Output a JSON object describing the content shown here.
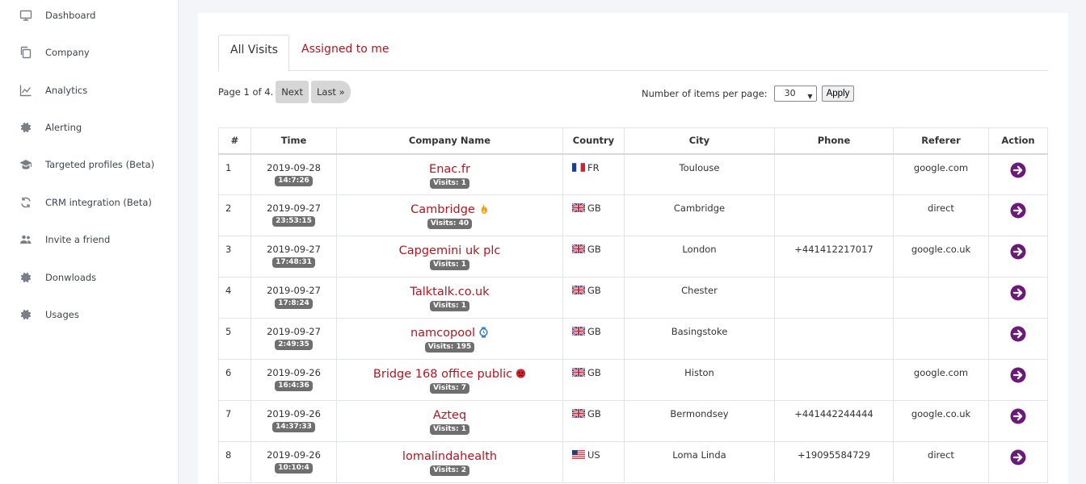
{
  "sidebar": {
    "items": [
      {
        "label": "Dashboard",
        "icon": "monitor-icon"
      },
      {
        "label": "Company",
        "icon": "copy-icon"
      },
      {
        "label": "Analytics",
        "icon": "line-chart-icon"
      },
      {
        "label": "Alerting",
        "icon": "gear-icon"
      },
      {
        "label": "Targeted profiles (Beta)",
        "icon": "graduation-cap-icon"
      },
      {
        "label": "CRM integration (Beta)",
        "icon": "sync-icon"
      },
      {
        "label": "Invite a friend",
        "icon": "users-icon"
      },
      {
        "label": "Donwloads",
        "icon": "gear-icon"
      },
      {
        "label": "Usages",
        "icon": "gear-icon"
      }
    ]
  },
  "tabs": [
    {
      "label": "All Visits",
      "active": true
    },
    {
      "label": "Assigned to me",
      "active": false
    }
  ],
  "pager": {
    "text": "Page 1 of 4.",
    "next_label": "Next",
    "last_label": "Last »"
  },
  "perpage": {
    "label": "Number of items per page:",
    "selected": "30",
    "apply_label": "Apply"
  },
  "table": {
    "headers": [
      "#",
      "Time",
      "Company Name",
      "Country",
      "City",
      "Phone",
      "Referer",
      "Action"
    ],
    "rows": [
      {
        "num": "1",
        "date": "2019-09-28",
        "time": "14:7:26",
        "company": "Enac.fr",
        "visits": "Visits: 1",
        "extra": "",
        "flag": "fr",
        "country": "FR",
        "city": "Toulouse",
        "phone": "",
        "referer": "google.com"
      },
      {
        "num": "2",
        "date": "2019-09-27",
        "time": "23:53:15",
        "company": "Cambridge",
        "visits": "Visits: 40",
        "extra": "fire-icon",
        "flag": "gb",
        "country": "GB",
        "city": "Cambridge",
        "phone": "",
        "referer": "direct"
      },
      {
        "num": "3",
        "date": "2019-09-27",
        "time": "17:48:31",
        "company": "Capgemini uk plc",
        "visits": "Visits: 1",
        "extra": "",
        "flag": "gb",
        "country": "GB",
        "city": "London",
        "phone": "+441412217017",
        "referer": "google.co.uk"
      },
      {
        "num": "4",
        "date": "2019-09-27",
        "time": "17:8:24",
        "company": "Talktalk.co.uk",
        "visits": "Visits: 1",
        "extra": "",
        "flag": "gb",
        "country": "GB",
        "city": "Chester",
        "phone": "",
        "referer": ""
      },
      {
        "num": "5",
        "date": "2019-09-27",
        "time": "2:49:35",
        "company": "namcopool",
        "visits": "Visits: 195",
        "extra": "watch-icon",
        "flag": "gb",
        "country": "GB",
        "city": "Basingstoke",
        "phone": "",
        "referer": ""
      },
      {
        "num": "6",
        "date": "2019-09-26",
        "time": "16:4:36",
        "company": "Bridge 168 office public",
        "visits": "Visits: 7",
        "extra": "angry-face-icon",
        "flag": "gb",
        "country": "GB",
        "city": "Histon",
        "phone": "",
        "referer": "google.com"
      },
      {
        "num": "7",
        "date": "2019-09-26",
        "time": "14:37:33",
        "company": "Azteq",
        "visits": "Visits: 1",
        "extra": "",
        "flag": "gb",
        "country": "GB",
        "city": "Bermondsey",
        "phone": "+441442244444",
        "referer": "google.co.uk"
      },
      {
        "num": "8",
        "date": "2019-09-26",
        "time": "10:10:4",
        "company": "lomalindahealth",
        "visits": "Visits: 2",
        "extra": "",
        "flag": "us",
        "country": "US",
        "city": "Loma Linda",
        "phone": "+19095584729",
        "referer": "direct"
      }
    ]
  },
  "colors": {
    "accent_red": "#b5141f",
    "action_purple": "#6b1a7a",
    "badge_gray": "#6f6f6f"
  }
}
